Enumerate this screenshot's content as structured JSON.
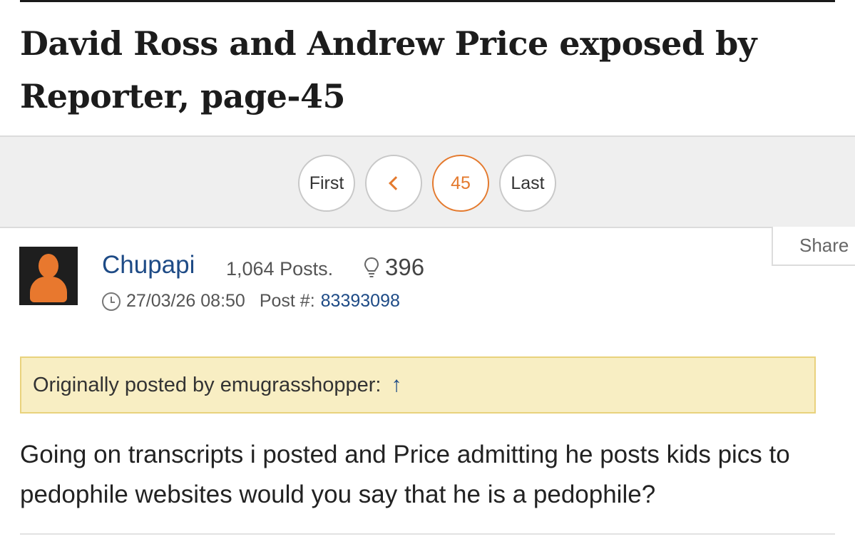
{
  "thread": {
    "title": "David Ross and Andrew Price exposed by Reporter, page-45"
  },
  "pagination": {
    "first_label": "First",
    "current_page": "45",
    "last_label": "Last",
    "accent_color": "#e47a2e"
  },
  "share": {
    "label": "Share"
  },
  "post": {
    "username": "Chupapi",
    "post_count": "1,064 Posts.",
    "likes": "396",
    "timestamp": "27/03/26 08:50",
    "post_label": "Post #:",
    "post_number": "83393098",
    "quote": {
      "text": "Originally posted by emugrasshopper:",
      "arrow": "↑"
    },
    "body": "Going on transcripts i posted and Price admitting he posts kids pics to pedophile websites would you say that he is a pedophile?"
  }
}
